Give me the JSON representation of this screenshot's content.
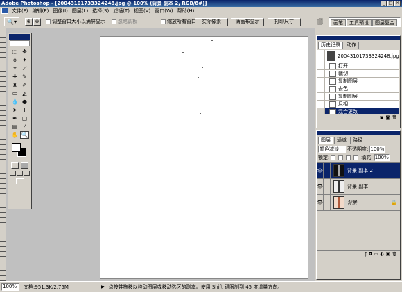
{
  "window": {
    "title": "Adobe Photoshop - [20043101733324248.jpg @ 100% (背景 副本 2, RGB/8#)]"
  },
  "menu": [
    "文件(F)",
    "编辑(E)",
    "图像(I)",
    "图层(L)",
    "选择(S)",
    "滤镜(T)",
    "视图(V)",
    "窗口(W)",
    "帮助(H)"
  ],
  "options": {
    "resize_windows": "调整窗口大小以满屏显示",
    "ignore_palettes": "忽略调板",
    "zoom_all": "缩放所有窗口",
    "actual_pixels": "实际像素",
    "fit_screen": "满画布显示",
    "print_size": "打印尺寸",
    "well_tabs": [
      "画笔",
      "工具预设",
      "图层复合"
    ]
  },
  "history": {
    "tabs": [
      "历史记录",
      "动作"
    ],
    "snapshot": "20043101733324248.jpg",
    "items": [
      "打开",
      "裁切",
      "复制图层",
      "去色",
      "复制图层",
      "反相",
      "混合更改"
    ],
    "selected_index": 6
  },
  "layers": {
    "tabs": [
      "图层",
      "通道",
      "路径"
    ],
    "blend_mode": "颜色减淡",
    "opacity_label": "不透明度:",
    "opacity_value": "100%",
    "lock_label": "锁定:",
    "fill_label": "填充:",
    "fill_value": "100%",
    "items": [
      {
        "name": "背景 副本 2",
        "selected": true
      },
      {
        "name": "背景 副本",
        "selected": false
      },
      {
        "name": "背景",
        "selected": false
      }
    ]
  },
  "status": {
    "zoom": "100%",
    "doc": "文档:951.3K/2.75M",
    "hint": "点按并拖移以移动图层或移动选区的副本。使用 Shift 键限制到 45 度增量方向。"
  },
  "colors": {
    "selection": "#0a246a",
    "chrome": "#d4d0c8"
  }
}
